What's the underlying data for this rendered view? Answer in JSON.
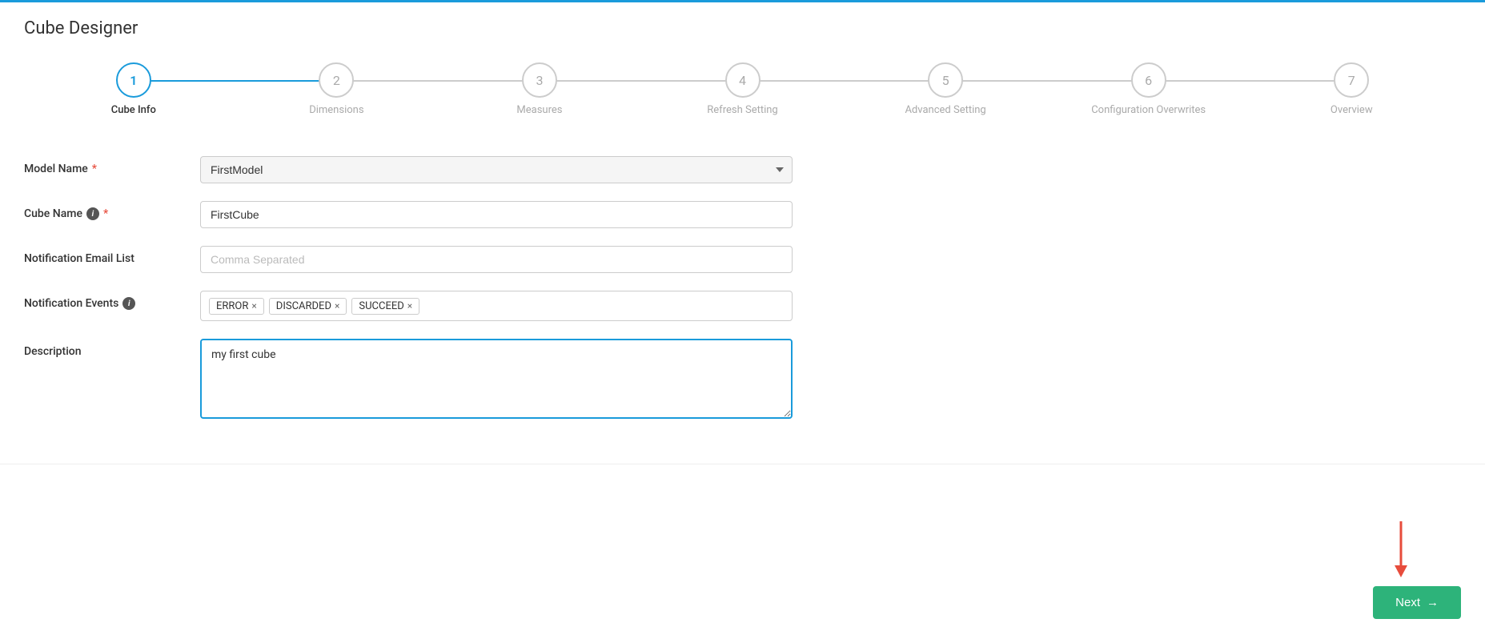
{
  "page": {
    "title": "Cube Designer"
  },
  "stepper": {
    "steps": [
      {
        "number": "1",
        "label": "Cube Info",
        "active": true
      },
      {
        "number": "2",
        "label": "Dimensions",
        "active": false
      },
      {
        "number": "3",
        "label": "Measures",
        "active": false
      },
      {
        "number": "4",
        "label": "Refresh Setting",
        "active": false
      },
      {
        "number": "5",
        "label": "Advanced Setting",
        "active": false
      },
      {
        "number": "6",
        "label": "Configuration Overwrites",
        "active": false
      },
      {
        "number": "7",
        "label": "Overview",
        "active": false
      }
    ]
  },
  "form": {
    "model_name": {
      "label": "Model Name",
      "required": true,
      "value": "FirstModel",
      "options": [
        "FirstModel"
      ]
    },
    "cube_name": {
      "label": "Cube Name",
      "required": true,
      "has_info": true,
      "value": "FirstCube",
      "placeholder": ""
    },
    "notification_email": {
      "label": "Notification Email List",
      "required": false,
      "has_info": false,
      "value": "",
      "placeholder": "Comma Separated"
    },
    "notification_events": {
      "label": "Notification Events",
      "required": false,
      "has_info": true,
      "tags": [
        "ERROR",
        "DISCARDED",
        "SUCCEED"
      ]
    },
    "description": {
      "label": "Description",
      "required": false,
      "has_info": false,
      "value": "my first cube"
    }
  },
  "buttons": {
    "next_label": "Next",
    "next_arrow": "→"
  },
  "icons": {
    "info": "i",
    "required": "*",
    "tag_remove": "×",
    "dropdown_arrow": "▼",
    "next_arrow": "→"
  }
}
